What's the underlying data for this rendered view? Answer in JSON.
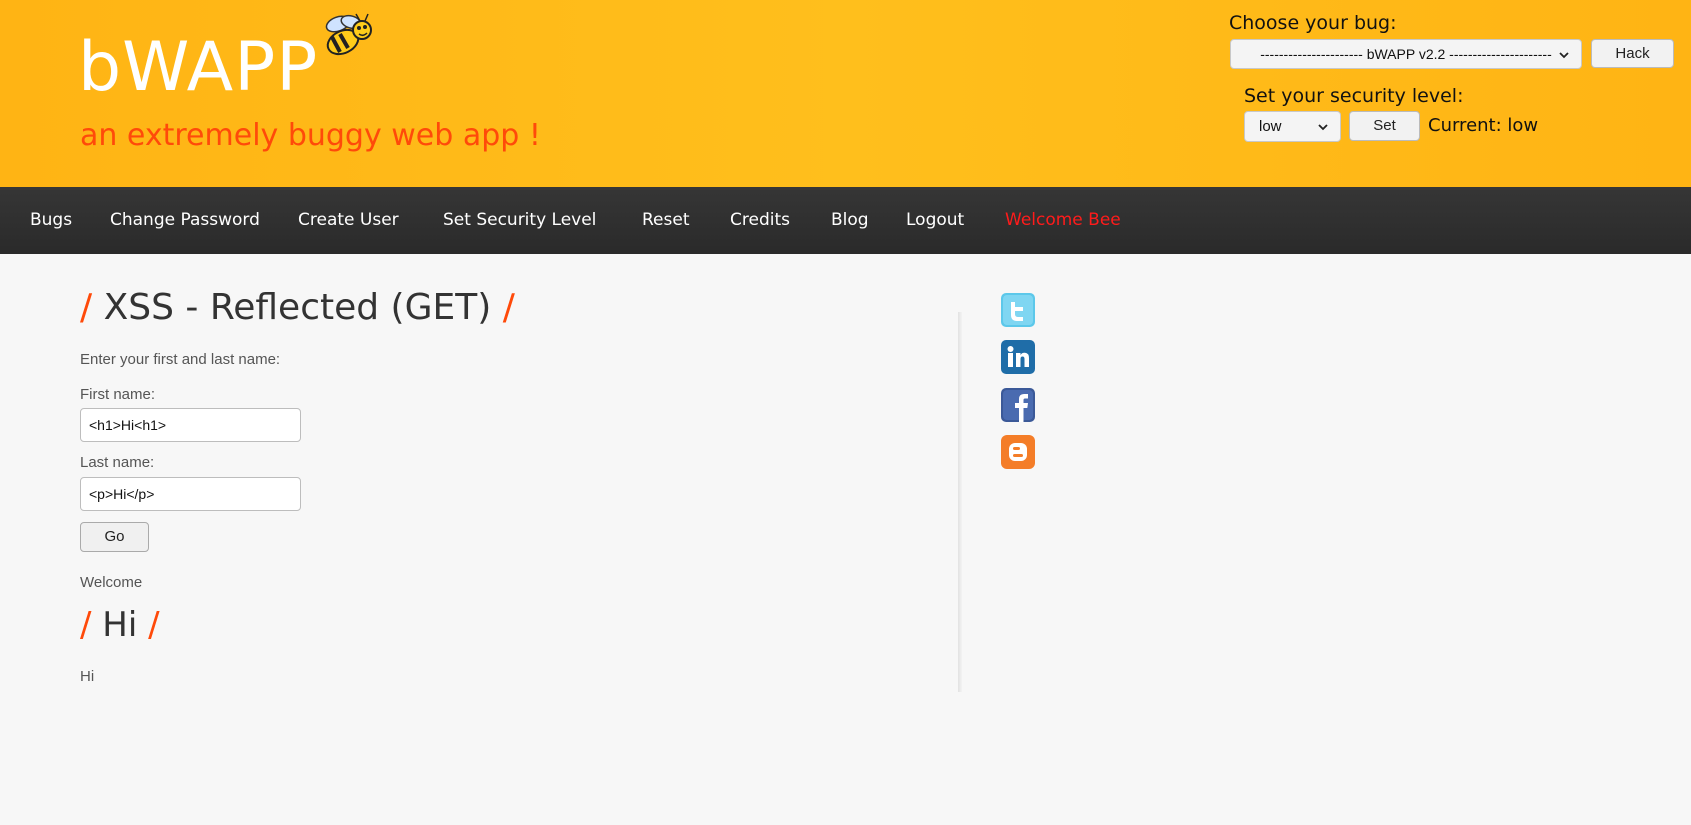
{
  "header": {
    "logo": "bWAPP",
    "tagline": "an extremely buggy web app !",
    "choose_label": "Choose your bug:",
    "bug_select_value": "---------------------- bWAPP v2.2 ----------------------",
    "hack_label": "Hack",
    "security_label": "Set your security level:",
    "security_select_value": "low",
    "set_label": "Set",
    "current_level": "Current: low"
  },
  "nav": {
    "items": [
      "Bugs",
      "Change Password",
      "Create User",
      "Set Security Level",
      "Reset",
      "Credits",
      "Blog",
      "Logout"
    ],
    "welcome": "Welcome Bee"
  },
  "main": {
    "title_slash_left": "/",
    "title": "XSS - Reflected (GET)",
    "title_slash_right": "/",
    "instructions": "Enter your first and last name:",
    "first_name_label": "First name:",
    "first_name_value": "<h1>Hi<h1>",
    "last_name_label": "Last name:",
    "last_name_value": "<p>Hi</p>",
    "go_label": "Go",
    "welcome_text": "Welcome",
    "output_heading": "Hi",
    "output_paragraph": "Hi"
  },
  "social": {
    "icons": [
      "twitter-icon",
      "linkedin-icon",
      "facebook-icon",
      "blogger-icon"
    ]
  },
  "colors": {
    "header_bg": "#ffb414",
    "accent": "#ff4a0a",
    "nav_bg": "#2f2f2f",
    "welcome_red": "#ff1b1b"
  }
}
